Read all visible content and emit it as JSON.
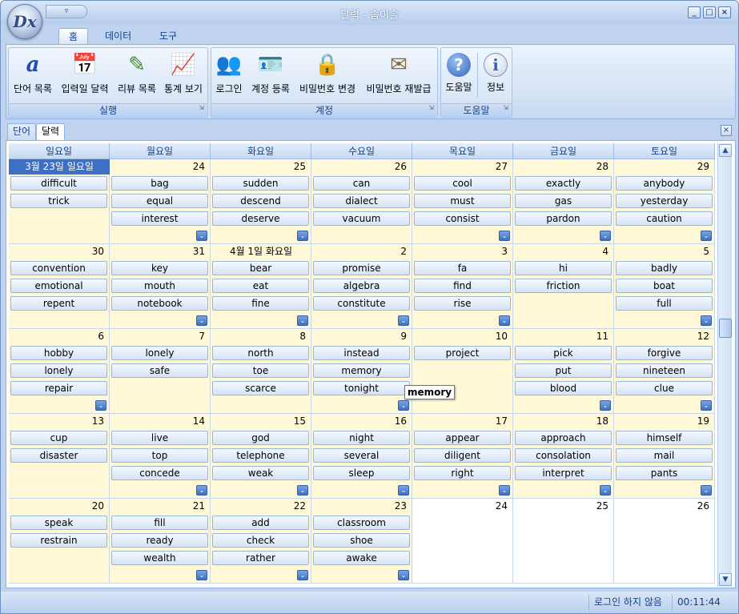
{
  "window": {
    "title": "달력 - 솜이솔",
    "logo_text": "Dx",
    "qat_glyph": "▿"
  },
  "window_buttons": {
    "minimize": "_",
    "maximize": "□",
    "close": "×"
  },
  "ribbon_tabs": [
    {
      "label": "홈"
    },
    {
      "label": "데이터"
    },
    {
      "label": "도구"
    }
  ],
  "ribbon_groups": [
    {
      "label": "실행",
      "buttons": [
        {
          "label": "단어 목록",
          "icon": "a"
        },
        {
          "label": "입력일 달력",
          "icon": "📅"
        },
        {
          "label": "리뷰 목록",
          "icon": "✎"
        },
        {
          "label": "통계 보기",
          "icon": "📈"
        }
      ]
    },
    {
      "label": "계정",
      "buttons": [
        {
          "label": "로그인",
          "icon": "👥"
        },
        {
          "label": "계정 등록",
          "icon": "🪪"
        },
        {
          "label": "비밀번호 변경",
          "icon": "🔒"
        },
        {
          "label": "비밀번호 재발급",
          "icon": "✉"
        }
      ]
    },
    {
      "label": "도움말",
      "buttons": [
        {
          "label": "도움말",
          "icon": "?"
        },
        {
          "label": "정보",
          "icon": "i"
        }
      ]
    }
  ],
  "group_launcher_glyph": "⇲",
  "doc_tabs": [
    {
      "label": "단어"
    },
    {
      "label": "달력"
    }
  ],
  "doc_close": "×",
  "weekdays": [
    "일요일",
    "월요일",
    "화요일",
    "수요일",
    "목요일",
    "금요일",
    "토요일"
  ],
  "more_glyph": "⌄",
  "weeks": [
    [
      {
        "day": "3월 23일 일요일",
        "label_style": "sel",
        "words": [
          "difficult",
          "trick"
        ],
        "more": false
      },
      {
        "day": "24",
        "words": [
          "bag",
          "equal",
          "interest"
        ],
        "more": true
      },
      {
        "day": "25",
        "words": [
          "sudden",
          "descend",
          "deserve"
        ],
        "more": true
      },
      {
        "day": "26",
        "words": [
          "can",
          "dialect",
          "vacuum"
        ],
        "more": false
      },
      {
        "day": "27",
        "words": [
          "cool",
          "must",
          "consist"
        ],
        "more": true
      },
      {
        "day": "28",
        "words": [
          "exactly",
          "gas",
          "pardon"
        ],
        "more": true
      },
      {
        "day": "29",
        "words": [
          "anybody",
          "yesterday",
          "caution"
        ],
        "more": true
      }
    ],
    [
      {
        "day": "30",
        "words": [
          "convention",
          "emotional",
          "repent"
        ],
        "more": false
      },
      {
        "day": "31",
        "words": [
          "key",
          "mouth",
          "notebook"
        ],
        "more": true
      },
      {
        "day": "4월 1일 화요일",
        "label_style": "plain",
        "words": [
          "bear",
          "eat",
          "fine"
        ],
        "more": true
      },
      {
        "day": "2",
        "words": [
          "promise",
          "algebra",
          "constitute"
        ],
        "more": true
      },
      {
        "day": "3",
        "words": [
          "fa",
          "find",
          "rise"
        ],
        "more": true
      },
      {
        "day": "4",
        "words": [
          "hi",
          "friction"
        ],
        "more": false
      },
      {
        "day": "5",
        "words": [
          "badly",
          "boat",
          "full"
        ],
        "more": true
      }
    ],
    [
      {
        "day": "6",
        "words": [
          "hobby",
          "lonely",
          "repair"
        ],
        "more": true
      },
      {
        "day": "7",
        "words": [
          "lonely",
          "safe"
        ],
        "more": false
      },
      {
        "day": "8",
        "words": [
          "north",
          "toe",
          "scarce"
        ],
        "more": false
      },
      {
        "day": "9",
        "words": [
          "instead",
          "memory",
          "tonight"
        ],
        "more": true
      },
      {
        "day": "10",
        "words": [
          "project"
        ],
        "more": false
      },
      {
        "day": "11",
        "words": [
          "pick",
          "put",
          "blood"
        ],
        "more": true
      },
      {
        "day": "12",
        "words": [
          "forgive",
          "nineteen",
          "clue"
        ],
        "more": true
      }
    ],
    [
      {
        "day": "13",
        "words": [
          "cup",
          "disaster"
        ],
        "more": false
      },
      {
        "day": "14",
        "words": [
          "live",
          "top",
          "concede"
        ],
        "more": true
      },
      {
        "day": "15",
        "words": [
          "god",
          "telephone",
          "weak"
        ],
        "more": true
      },
      {
        "day": "16",
        "words": [
          "night",
          "several",
          "sleep"
        ],
        "more": true
      },
      {
        "day": "17",
        "words": [
          "appear",
          "diligent",
          "right"
        ],
        "more": true
      },
      {
        "day": "18",
        "words": [
          "approach",
          "consolation",
          "interpret"
        ],
        "more": true
      },
      {
        "day": "19",
        "words": [
          "himself",
          "mail",
          "pants"
        ],
        "more": true
      }
    ],
    [
      {
        "day": "20",
        "words": [
          "speak",
          "restrain"
        ],
        "more": false
      },
      {
        "day": "21",
        "words": [
          "fill",
          "ready",
          "wealth"
        ],
        "more": true
      },
      {
        "day": "22",
        "words": [
          "add",
          "check",
          "rather"
        ],
        "more": true
      },
      {
        "day": "23",
        "words": [
          "classroom",
          "shoe",
          "awake"
        ],
        "more": true
      },
      {
        "day": "24",
        "words": [],
        "more": false,
        "out": true
      },
      {
        "day": "25",
        "words": [],
        "more": false,
        "out": true
      },
      {
        "day": "26",
        "words": [],
        "more": false,
        "out": true
      }
    ]
  ],
  "scrollbar": {
    "up": "▲",
    "down": "▼"
  },
  "tooltip": {
    "text": "memory"
  },
  "status": {
    "login": "로그인 하지 않음",
    "time": "00:11:44"
  }
}
